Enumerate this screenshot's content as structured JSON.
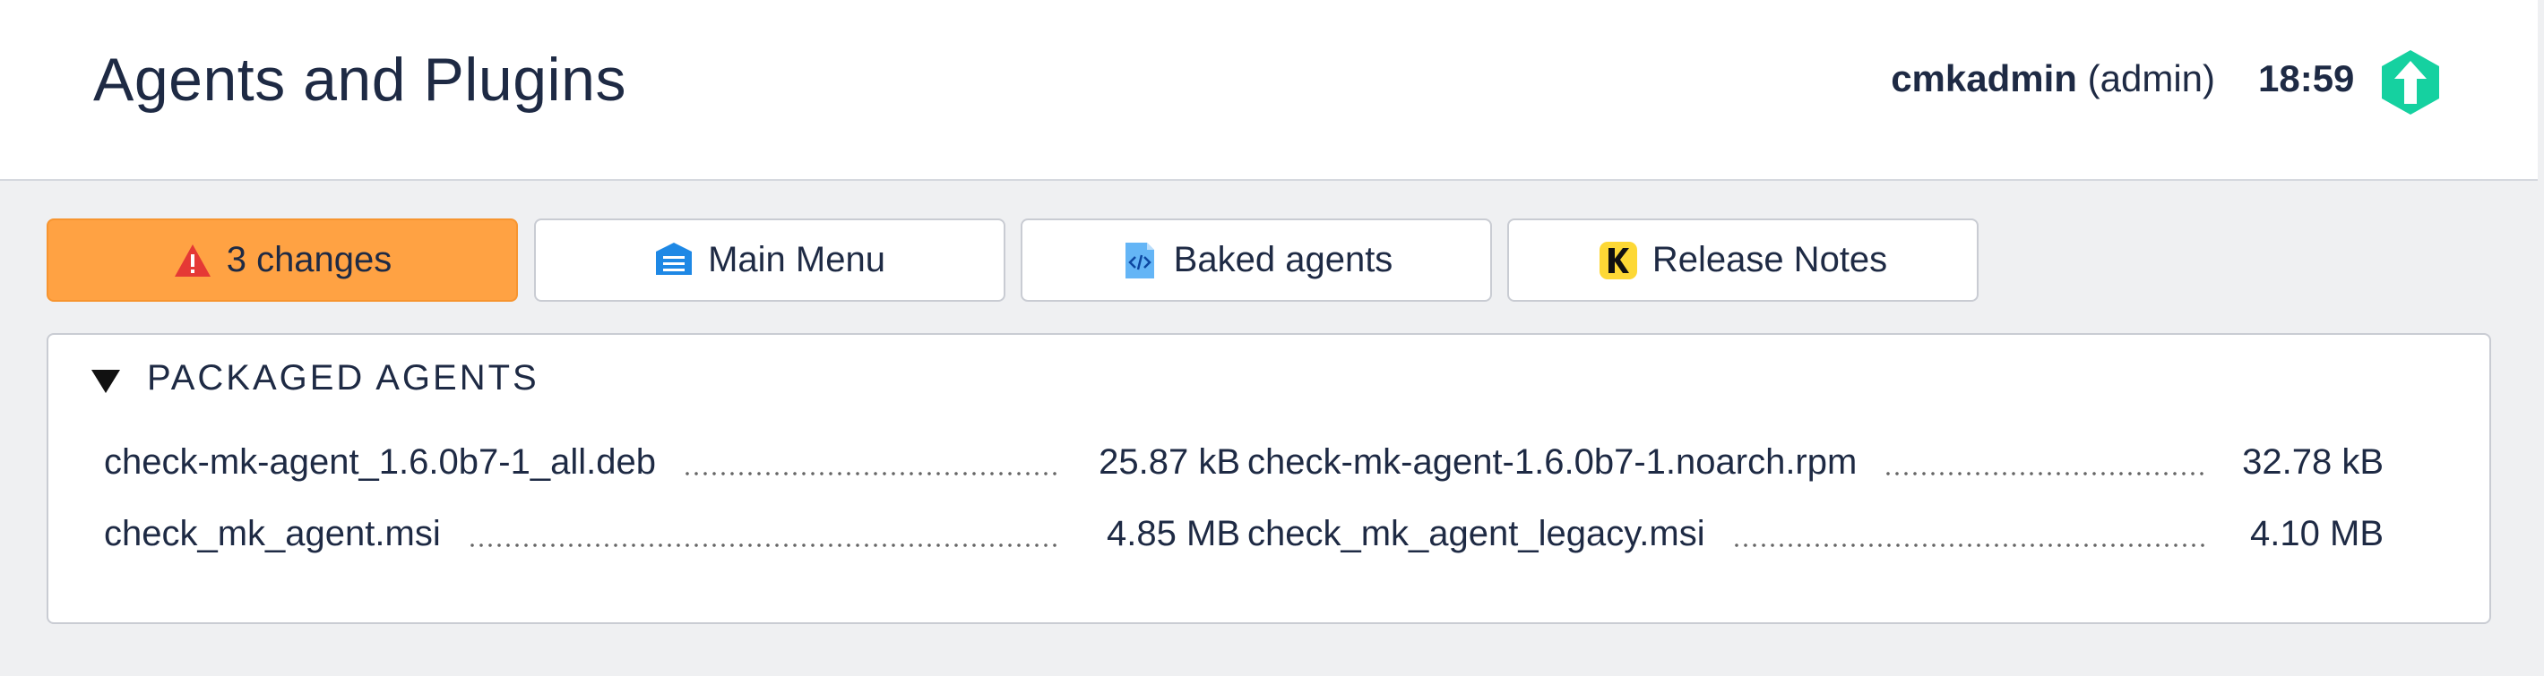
{
  "header": {
    "title": "Agents and Plugins",
    "username": "cmkadmin",
    "role": "(admin)",
    "time": "18:59",
    "logo_icon": "checkmk-logo-icon"
  },
  "toolbar": {
    "buttons": [
      {
        "label": "3 changes",
        "icon": "warning-icon",
        "color": "#ffa243"
      },
      {
        "label": "Main Menu",
        "icon": "main-menu-icon"
      },
      {
        "label": "Baked agents",
        "icon": "code-file-icon"
      },
      {
        "label": "Release Notes",
        "icon": "release-notes-icon"
      }
    ]
  },
  "packaged_agents": {
    "heading": "PACKAGED AGENTS",
    "files": [
      {
        "name": "check-mk-agent_1.6.0b7-1_all.deb",
        "size": "25.87 kB"
      },
      {
        "name": "check-mk-agent-1.6.0b7-1.noarch.rpm",
        "size": "32.78 kB"
      },
      {
        "name": "check_mk_agent.msi",
        "size": "4.85 MB"
      },
      {
        "name": "check_mk_agent_legacy.msi",
        "size": "4.10 MB"
      }
    ]
  },
  "colors": {
    "accent": "#ffa243",
    "brand": "#15d1a0",
    "text": "#1e2a44",
    "background": "#eff0f2"
  }
}
